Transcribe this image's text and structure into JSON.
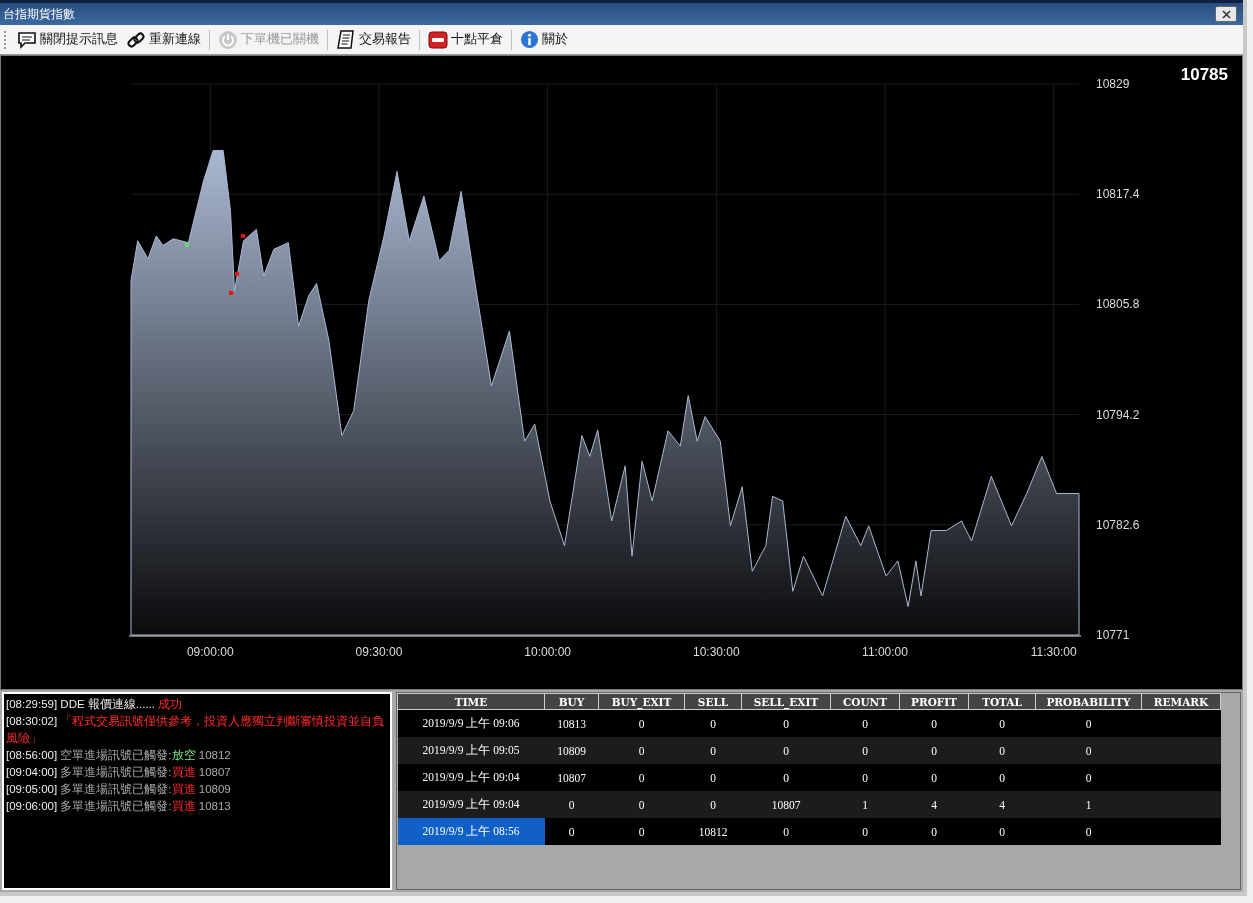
{
  "window": {
    "title": "台指期貨指數"
  },
  "toolbar": [
    {
      "label": "關閉提示訊息",
      "disabled": false,
      "group_start": false
    },
    {
      "label": "重新連線",
      "disabled": false,
      "group_start": false
    },
    {
      "label": "下單機已關機",
      "disabled": true,
      "group_start": true
    },
    {
      "label": "交易報告",
      "disabled": false,
      "group_start": true
    },
    {
      "label": "十點平倉",
      "disabled": false,
      "group_start": true
    },
    {
      "label": "關於",
      "disabled": false,
      "group_start": true
    }
  ],
  "chart": {
    "current_price": "10785",
    "chart_data": {
      "type": "area",
      "x": [
        525.9,
        527.1,
        528.9,
        530.4,
        531.6,
        533.4,
        536.1,
        538.8,
        540.5,
        542.3,
        543.6,
        544.3,
        545.9,
        548.2,
        549.5,
        551.3,
        553.9,
        555.7,
        557.5,
        558.9,
        561.1,
        563.4,
        565.5,
        568.2,
        570.9,
        573.2,
        575.4,
        578.0,
        580.7,
        582.5,
        584.6,
        587.0,
        590.0,
        593.2,
        595.9,
        597.7,
        600.4,
        603.0,
        606.1,
        607.5,
        608.9,
        611.4,
        613.8,
        615.0,
        616.8,
        618.6,
        621.4,
        623.6,
        625.0,
        626.6,
        628.0,
        630.7,
        632.5,
        634.6,
        636.4,
        638.8,
        640.0,
        641.8,
        643.6,
        645.5,
        648.9,
        653.0,
        655.7,
        657.1,
        660.2,
        662.3,
        664.1,
        665.5,
        666.4,
        668.2,
        670.9,
        673.6,
        675.4,
        678.9,
        682.5,
        685.2,
        687.9,
        690.5,
        694.5
      ],
      "series": [
        {
          "color": "#a9b8d2",
          "values": [
            10808.3,
            10812.5,
            10810.6,
            10813,
            10812,
            10812.7,
            10812.3,
            10818.8,
            10822,
            10822,
            10815.6,
            10807.2,
            10812.5,
            10813.7,
            10808.8,
            10811.6,
            10812.3,
            10803.5,
            10806.7,
            10808,
            10802,
            10792,
            10794.6,
            10806.2,
            10813,
            10819.8,
            10812.5,
            10817.2,
            10810.4,
            10811.5,
            10817.7,
            10808.3,
            10797.2,
            10803,
            10791.4,
            10793.2,
            10785.1,
            10780.4,
            10792,
            10789.8,
            10792.6,
            10783,
            10788.8,
            10779.3,
            10789.3,
            10785.1,
            10792.5,
            10790.9,
            10796.2,
            10791.4,
            10794,
            10791.4,
            10782.5,
            10786.6,
            10777.7,
            10780.4,
            10785.6,
            10785.1,
            10775.6,
            10779.3,
            10775.1,
            10783.5,
            10780.4,
            10782.5,
            10777.2,
            10778.8,
            10774,
            10778.8,
            10775.1,
            10782,
            10782,
            10783,
            10780.9,
            10787.7,
            10782.5,
            10785.9,
            10789.8,
            10785.9,
            10785.9
          ]
        }
      ],
      "xlim": [
        525.9,
        694.5
      ],
      "ylim": [
        10771,
        10829
      ],
      "xticks": [
        {
          "value": 540,
          "label": "09:00:00"
        },
        {
          "value": 570,
          "label": "09:30:00"
        },
        {
          "value": 600,
          "label": "10:00:00"
        },
        {
          "value": 630,
          "label": "10:30:00"
        },
        {
          "value": 660,
          "label": "11:00:00"
        },
        {
          "value": 690,
          "label": "11:30:00"
        }
      ],
      "yticks": [
        {
          "value": 10771,
          "label": "10771"
        },
        {
          "value": 10782.6,
          "label": "10782.6"
        },
        {
          "value": 10794.2,
          "label": "10794.2"
        },
        {
          "value": 10805.8,
          "label": "10805.8"
        },
        {
          "value": 10817.4,
          "label": "10817.4"
        },
        {
          "value": 10829,
          "label": "10829"
        }
      ],
      "grid": true
    }
  },
  "log": [
    {
      "parts": [
        {
          "text": "[08:29:59]",
          "kind": "plain"
        },
        {
          "text": " DDE 報價連線......",
          "kind": "plain"
        },
        {
          "text": " 成功",
          "kind": "alert"
        }
      ]
    },
    {
      "parts": [
        {
          "text": "[08:30:02]",
          "kind": "plain"
        },
        {
          "text": " 「程式交易訊號僅供參考，投資人應獨立判斷審慎投資並自負風險」",
          "kind": "alert"
        }
      ]
    },
    {
      "parts": [
        {
          "text": "[08:56:00]",
          "kind": "plain"
        },
        {
          "text": " 空單進場訊號已觸發:",
          "kind": "dim"
        },
        {
          "text": "放空",
          "kind": "short"
        },
        {
          "text": " 10812",
          "kind": "dim"
        }
      ]
    },
    {
      "parts": [
        {
          "text": "[09:04:00]",
          "kind": "plain"
        },
        {
          "text": " 多單進場訊號已觸發:",
          "kind": "dim"
        },
        {
          "text": "買進",
          "kind": "alert"
        },
        {
          "text": " 10807",
          "kind": "dim"
        }
      ]
    },
    {
      "parts": [
        {
          "text": "[09:05:00]",
          "kind": "plain"
        },
        {
          "text": " 多單進場訊號已觸發:",
          "kind": "dim"
        },
        {
          "text": "買進",
          "kind": "alert"
        },
        {
          "text": " 10809",
          "kind": "dim"
        }
      ]
    },
    {
      "parts": [
        {
          "text": "[09:06:00]",
          "kind": "plain"
        },
        {
          "text": " 多單進場訊號已觸發:",
          "kind": "dim"
        },
        {
          "text": "買進",
          "kind": "alert"
        },
        {
          "text": " 10813",
          "kind": "dim"
        }
      ]
    }
  ],
  "table": {
    "columns": [
      "TIME",
      "BUY",
      "BUY_EXIT",
      "SELL",
      "SELL_EXIT",
      "COUNT",
      "PROFIT",
      "TOTAL",
      "PROBABILITY",
      "REMARK"
    ],
    "rows": [
      {
        "selected": false,
        "cells": [
          "2019/9/9 上午 09:06",
          "10813",
          "0",
          "0",
          "0",
          "0",
          "0",
          "0",
          "0"
        ]
      },
      {
        "selected": false,
        "cells": [
          "2019/9/9 上午 09:05",
          "10809",
          "0",
          "0",
          "0",
          "0",
          "0",
          "0",
          "0"
        ]
      },
      {
        "selected": false,
        "cells": [
          "2019/9/9 上午 09:04",
          "10807",
          "0",
          "0",
          "0",
          "0",
          "0",
          "0",
          "0"
        ]
      },
      {
        "selected": false,
        "cells": [
          "2019/9/9 上午 09:04",
          "0",
          "0",
          "0",
          "10807",
          "1",
          "4",
          "4",
          "1"
        ]
      },
      {
        "selected": true,
        "cells": [
          "2019/9/9 上午 08:56",
          "0",
          "0",
          "10812",
          "0",
          "0",
          "0",
          "0",
          "0"
        ]
      }
    ]
  }
}
